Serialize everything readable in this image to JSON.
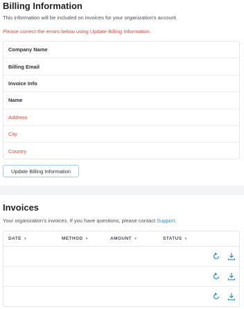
{
  "billing": {
    "title": "Billing Information",
    "description": "This information will be included on invoices for your organization's account.",
    "error_note": "Please correct the errors below using Update Billing Information.",
    "fields": [
      {
        "label": "Company Name",
        "status": "ok"
      },
      {
        "label": "Billing Email",
        "status": "ok"
      },
      {
        "label": "Invoice Info",
        "status": "ok"
      },
      {
        "label": "Name",
        "status": "ok"
      },
      {
        "label": "Address",
        "status": "error"
      },
      {
        "label": "City",
        "status": "error"
      },
      {
        "label": "Country",
        "status": "error"
      }
    ],
    "update_button": "Update Billing Information"
  },
  "invoices": {
    "title": "Invoices",
    "description_prefix": "Your organization's invoices. If you have questions, please contact",
    "support_link": "Support",
    "description_suffix": ".",
    "columns": [
      {
        "label": "DATE"
      },
      {
        "label": "METHOD"
      },
      {
        "label": "AMOUNT"
      },
      {
        "label": "STATUS"
      }
    ],
    "rows": [
      {
        "actions": [
          "refresh-icon",
          "download-icon"
        ]
      },
      {
        "actions": [
          "refresh-icon",
          "download-icon"
        ]
      },
      {
        "actions": [
          "refresh-icon",
          "download-icon"
        ]
      }
    ],
    "sort_icon": "chevron-down-icon"
  },
  "colors": {
    "error": "#e5483c",
    "link": "#2f8fc0",
    "icon": "#2f8fc0"
  }
}
